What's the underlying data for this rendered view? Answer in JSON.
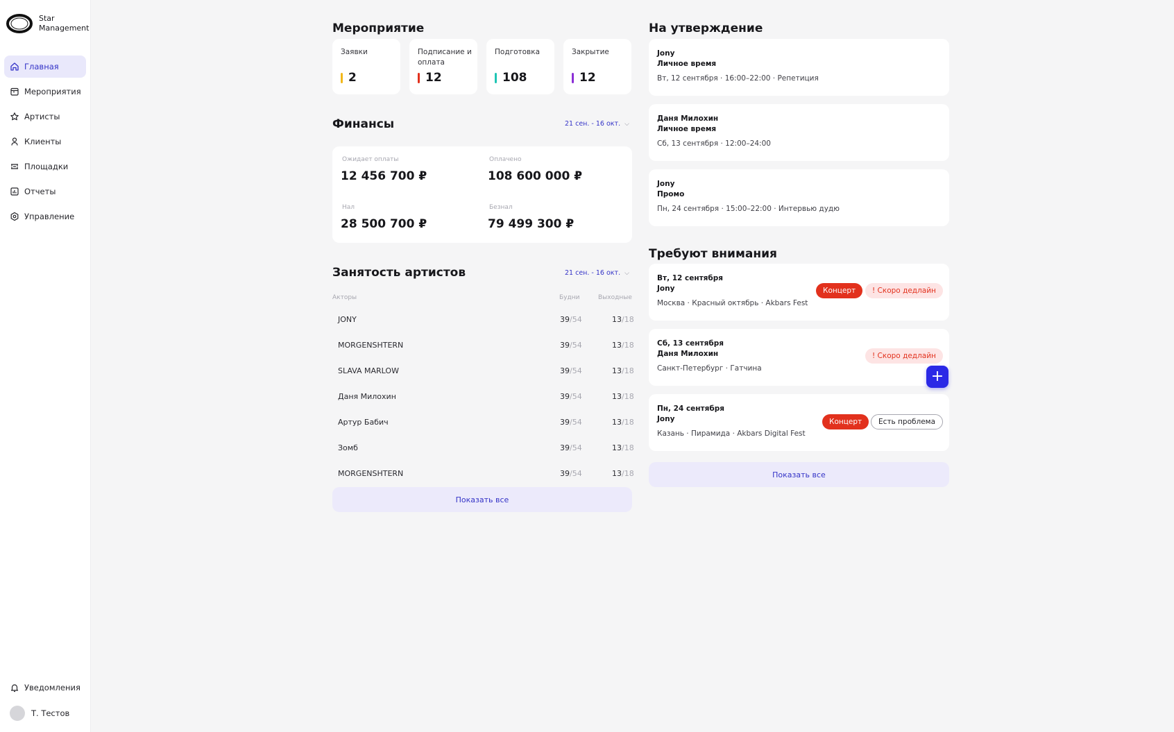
{
  "brand": {
    "name_line1": "Star",
    "name_line2": "Management"
  },
  "nav": {
    "items": [
      {
        "label": "Главная",
        "icon": "home-icon",
        "active": true
      },
      {
        "label": "Мероприятия",
        "icon": "calendar-icon"
      },
      {
        "label": "Артисты",
        "icon": "star-icon"
      },
      {
        "label": "Клиенты",
        "icon": "user-icon"
      },
      {
        "label": "Площадки",
        "icon": "venue-icon"
      },
      {
        "label": "Отчеты",
        "icon": "report-icon"
      },
      {
        "label": "Управление",
        "icon": "settings-icon"
      }
    ],
    "notifications": "Уведомления",
    "user": "Т. Тестов"
  },
  "events": {
    "title": "Мероприятие",
    "stats": [
      {
        "label": "Заявки",
        "value": "2",
        "color": "#f2b81b"
      },
      {
        "label": "Подписание и оплата",
        "value": "12",
        "color": "#e2311d"
      },
      {
        "label": "Подготовка",
        "value": "108",
        "color": "#1fc5b4"
      },
      {
        "label": "Закрытие",
        "value": "12",
        "color": "#8b2fd6"
      }
    ]
  },
  "finance": {
    "title": "Финансы",
    "range": "21 сен. - 16 окт.",
    "awaiting_label": "Ожидает оплаты",
    "awaiting_value": "12 456 700 ₽",
    "paid_label": "Оплачено",
    "paid_value": "108 600 000 ₽",
    "cash_label": "Нал",
    "cash_value": "28 500 700 ₽",
    "cashless_label": "Безнал",
    "cashless_value": "79 499 300 ₽"
  },
  "occupancy": {
    "title": "Занятость артистов",
    "range": "21 сен. - 16 окт.",
    "col_actors": "Акторы",
    "col_weekdays": "Будни",
    "col_weekends": "Выходные",
    "rows": [
      {
        "name": "JONY",
        "wd_used": "39",
        "wd_total": "/54",
        "we_used": "13",
        "we_total": "/18"
      },
      {
        "name": "MORGENSHTERN",
        "wd_used": "39",
        "wd_total": "/54",
        "we_used": "13",
        "we_total": "/18"
      },
      {
        "name": "SLAVA MARLOW",
        "wd_used": "39",
        "wd_total": "/54",
        "we_used": "13",
        "we_total": "/18"
      },
      {
        "name": "Даня Милохин",
        "wd_used": "39",
        "wd_total": "/54",
        "we_used": "13",
        "we_total": "/18"
      },
      {
        "name": "Артур Бабич",
        "wd_used": "39",
        "wd_total": "/54",
        "we_used": "13",
        "we_total": "/18"
      },
      {
        "name": "Зомб",
        "wd_used": "39",
        "wd_total": "/54",
        "we_used": "13",
        "we_total": "/18"
      },
      {
        "name": "MORGENSHTERN",
        "wd_used": "39",
        "wd_total": "/54",
        "we_used": "13",
        "we_total": "/18"
      }
    ],
    "show_all": "Показать все"
  },
  "approval": {
    "title": "На утверждение",
    "items": [
      {
        "artist": "Jony",
        "type": "Личное время",
        "details": "Вт, 12 сентября  ·  16:00–22:00  ·  Репетиция"
      },
      {
        "artist": "Даня Милохин",
        "type": "Личное время",
        "details": "Сб, 13 сентября  ·  12:00–24:00"
      },
      {
        "artist": "Jony",
        "type": "Промо",
        "details": "Пн, 24 сентября  ·  15:00–22:00  ·  Интервью дудю"
      }
    ]
  },
  "attention": {
    "title": "Требуют внимания",
    "items": [
      {
        "date": "Вт, 12 сентября",
        "artist": "Jony",
        "details": "Москва  ·  Красный октябрь  ·  Akbars Fest",
        "tag": "Концерт",
        "flag": "! Скоро дедлайн"
      },
      {
        "date": "Сб, 13 сентября",
        "artist": "Даня Милохин",
        "details": "Санкт-Петербург  ·  Гатчина",
        "flag": "! Скоро дедлайн"
      },
      {
        "date": "Пн, 24 сентября",
        "artist": "Jony",
        "details": "Казань  ·  Пирамида  ·  Akbars Digital Fest",
        "tag": "Концерт",
        "flag": "Есть проблема"
      }
    ],
    "show_all": "Показать все"
  },
  "fab": {
    "label": "+"
  }
}
